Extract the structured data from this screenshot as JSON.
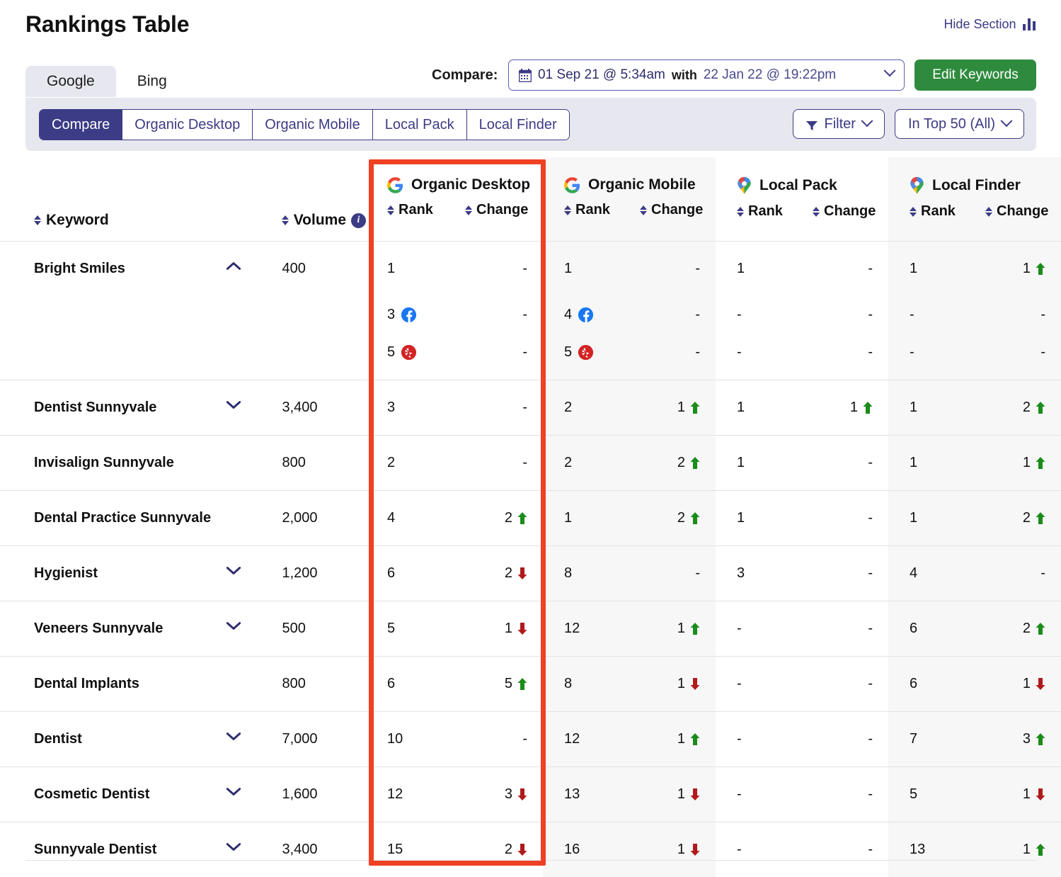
{
  "header": {
    "title": "Rankings Table",
    "hide_section_label": "Hide Section",
    "hide_section_icon": "bar-chart-icon"
  },
  "engine_tabs": [
    {
      "label": "Google",
      "active": true
    },
    {
      "label": "Bing",
      "active": false
    }
  ],
  "compare": {
    "label": "Compare:",
    "calendar_icon": "calendar-icon",
    "date_from": "01 Sep 21 @ 5:34am",
    "with_label": "with",
    "date_to": "22 Jan 22 @ 19:22pm",
    "caret_icon": "chevron-down-icon"
  },
  "edit_keywords_label": "Edit Keywords",
  "view_tabs": [
    {
      "label": "Compare",
      "active": true
    },
    {
      "label": "Organic Desktop",
      "active": false
    },
    {
      "label": "Organic Mobile",
      "active": false
    },
    {
      "label": "Local Pack",
      "active": false
    },
    {
      "label": "Local Finder",
      "active": false
    }
  ],
  "filters": {
    "filter_label": "Filter",
    "filter_icon": "funnel-icon",
    "top_label": "In Top 50 (All)"
  },
  "table": {
    "keyword_header": "Keyword",
    "volume_header": "Volume",
    "volume_info_icon": "info-icon",
    "rank_header": "Rank",
    "change_header": "Change",
    "groups": [
      {
        "name": "Organic Desktop",
        "icon": "google-icon",
        "shaded": false
      },
      {
        "name": "Organic Mobile",
        "icon": "google-icon",
        "shaded": true
      },
      {
        "name": "Local Pack",
        "icon": "google-maps-pin-icon",
        "shaded": false
      },
      {
        "name": "Local Finder",
        "icon": "google-maps-pin-icon",
        "shaded": true
      }
    ],
    "rows": [
      {
        "keyword": "Bright Smiles",
        "volume": "400",
        "trend_icon": "chevron-up-icon",
        "lines": [
          {
            "badge": null,
            "cells": [
              {
                "rank": "1",
                "change": "-",
                "dir": null
              },
              {
                "rank": "1",
                "change": "-",
                "dir": null
              },
              {
                "rank": "1",
                "change": "-",
                "dir": null
              },
              {
                "rank": "1",
                "change": "1",
                "dir": "up"
              }
            ]
          },
          {
            "badge": "facebook-icon",
            "cells": [
              {
                "rank": "3",
                "change": "-",
                "dir": null
              },
              {
                "rank": "4",
                "change": "-",
                "dir": null
              },
              {
                "rank": "-",
                "change": "-",
                "dir": null
              },
              {
                "rank": "-",
                "change": "-",
                "dir": null
              }
            ]
          },
          {
            "badge": "yelp-icon",
            "cells": [
              {
                "rank": "5",
                "change": "-",
                "dir": null
              },
              {
                "rank": "5",
                "change": "-",
                "dir": null
              },
              {
                "rank": "-",
                "change": "-",
                "dir": null
              },
              {
                "rank": "-",
                "change": "-",
                "dir": null
              }
            ]
          }
        ]
      },
      {
        "keyword": "Dentist Sunnyvale",
        "volume": "3,400",
        "trend_icon": "chevron-down-icon",
        "lines": [
          {
            "badge": null,
            "cells": [
              {
                "rank": "3",
                "change": "-",
                "dir": null
              },
              {
                "rank": "2",
                "change": "1",
                "dir": "up"
              },
              {
                "rank": "1",
                "change": "1",
                "dir": "up"
              },
              {
                "rank": "1",
                "change": "2",
                "dir": "up"
              }
            ]
          }
        ]
      },
      {
        "keyword": "Invisalign Sunnyvale",
        "volume": "800",
        "trend_icon": null,
        "lines": [
          {
            "badge": null,
            "cells": [
              {
                "rank": "2",
                "change": "-",
                "dir": null
              },
              {
                "rank": "2",
                "change": "2",
                "dir": "up"
              },
              {
                "rank": "1",
                "change": "-",
                "dir": null
              },
              {
                "rank": "1",
                "change": "1",
                "dir": "up"
              }
            ]
          }
        ]
      },
      {
        "keyword": "Dental Practice Sunnyvale",
        "volume": "2,000",
        "trend_icon": null,
        "lines": [
          {
            "badge": null,
            "cells": [
              {
                "rank": "4",
                "change": "2",
                "dir": "up"
              },
              {
                "rank": "1",
                "change": "2",
                "dir": "up"
              },
              {
                "rank": "1",
                "change": "-",
                "dir": null
              },
              {
                "rank": "1",
                "change": "2",
                "dir": "up"
              }
            ]
          }
        ]
      },
      {
        "keyword": "Hygienist",
        "volume": "1,200",
        "trend_icon": "chevron-down-icon",
        "lines": [
          {
            "badge": null,
            "cells": [
              {
                "rank": "6",
                "change": "2",
                "dir": "down"
              },
              {
                "rank": "8",
                "change": "-",
                "dir": null
              },
              {
                "rank": "3",
                "change": "-",
                "dir": null
              },
              {
                "rank": "4",
                "change": "-",
                "dir": null
              }
            ]
          }
        ]
      },
      {
        "keyword": "Veneers Sunnyvale",
        "volume": "500",
        "trend_icon": "chevron-down-icon",
        "lines": [
          {
            "badge": null,
            "cells": [
              {
                "rank": "5",
                "change": "1",
                "dir": "down"
              },
              {
                "rank": "12",
                "change": "1",
                "dir": "up"
              },
              {
                "rank": "-",
                "change": "-",
                "dir": null
              },
              {
                "rank": "6",
                "change": "2",
                "dir": "up"
              }
            ]
          }
        ]
      },
      {
        "keyword": "Dental Implants",
        "volume": "800",
        "trend_icon": null,
        "lines": [
          {
            "badge": null,
            "cells": [
              {
                "rank": "6",
                "change": "5",
                "dir": "up"
              },
              {
                "rank": "8",
                "change": "1",
                "dir": "down"
              },
              {
                "rank": "-",
                "change": "-",
                "dir": null
              },
              {
                "rank": "6",
                "change": "1",
                "dir": "down"
              }
            ]
          }
        ]
      },
      {
        "keyword": "Dentist",
        "volume": "7,000",
        "trend_icon": "chevron-down-icon",
        "lines": [
          {
            "badge": null,
            "cells": [
              {
                "rank": "10",
                "change": "-",
                "dir": null
              },
              {
                "rank": "12",
                "change": "1",
                "dir": "up"
              },
              {
                "rank": "-",
                "change": "-",
                "dir": null
              },
              {
                "rank": "7",
                "change": "3",
                "dir": "up"
              }
            ]
          }
        ]
      },
      {
        "keyword": "Cosmetic Dentist",
        "volume": "1,600",
        "trend_icon": "chevron-down-icon",
        "lines": [
          {
            "badge": null,
            "cells": [
              {
                "rank": "12",
                "change": "3",
                "dir": "down"
              },
              {
                "rank": "13",
                "change": "1",
                "dir": "down"
              },
              {
                "rank": "-",
                "change": "-",
                "dir": null
              },
              {
                "rank": "5",
                "change": "1",
                "dir": "down"
              }
            ]
          }
        ]
      },
      {
        "keyword": "Sunnyvale Dentist",
        "volume": "3,400",
        "trend_icon": "chevron-down-icon",
        "lines": [
          {
            "badge": null,
            "cells": [
              {
                "rank": "15",
                "change": "2",
                "dir": "down"
              },
              {
                "rank": "16",
                "change": "1",
                "dir": "down"
              },
              {
                "rank": "-",
                "change": "-",
                "dir": null
              },
              {
                "rank": "13",
                "change": "1",
                "dir": "up"
              }
            ]
          }
        ]
      }
    ]
  },
  "annotation": {
    "highlight_target": "Organic Desktop column",
    "highlight_color": "#ef4123"
  },
  "colors": {
    "brand_navy": "#3b3b86",
    "green": "#2e8b3d",
    "up_green": "#1a8c1a",
    "down_red": "#b01a1a",
    "toolbar_bg": "#e7e7ef",
    "shade": "#f7f7f8"
  }
}
